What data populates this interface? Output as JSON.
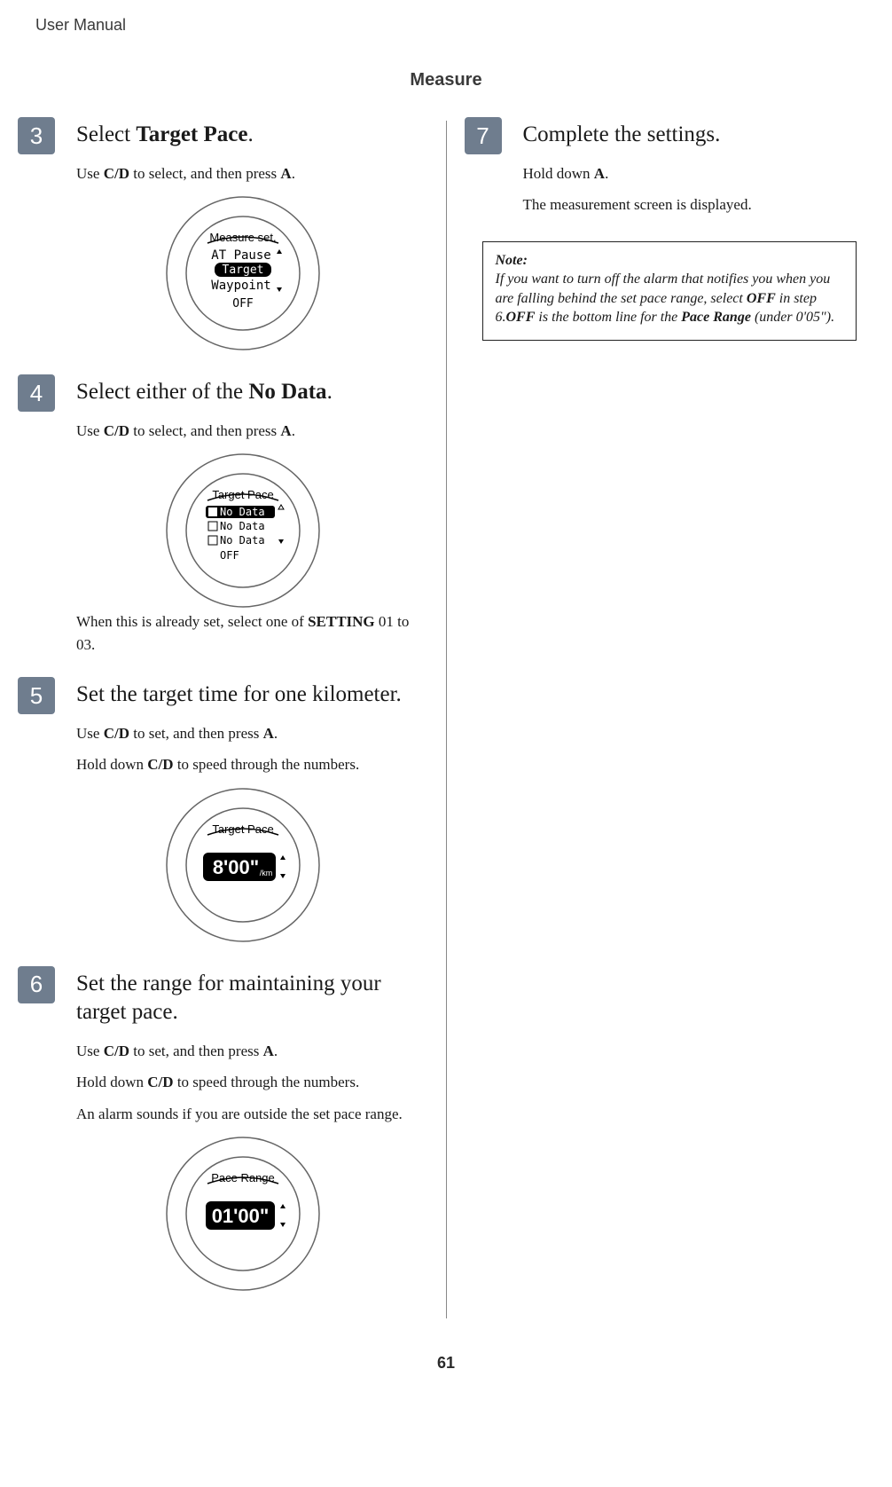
{
  "header": {
    "product": "User Manual",
    "chapter": "Measure"
  },
  "pageNumber": "61",
  "left": {
    "step3": {
      "num": "3",
      "title_pre": "Select ",
      "title_strong": "Target Pace",
      "title_post": ".",
      "body1_pre": "Use ",
      "body1_s1": "C/D",
      "body1_mid": " to select, and then press ",
      "body1_s2": "A",
      "body1_post": ".",
      "screen": {
        "title": "Measure set.",
        "line1": "AT Pause",
        "sel": "Target",
        "line3": "Waypoint",
        "bottom": "OFF"
      }
    },
    "step4": {
      "num": "4",
      "title_pre": "Select either of the ",
      "title_strong": "No Data",
      "title_post": ".",
      "body1_pre": "Use ",
      "body1_s1": "C/D",
      "body1_mid": " to select, and then press ",
      "body1_s2": "A",
      "body1_post": ".",
      "screen": {
        "title": "Target Pace",
        "opt1": "No Data",
        "opt2": "No Data",
        "opt3": "No Data",
        "bottom": "OFF"
      },
      "extra_pre": "When this is already set, select one of ",
      "extra_strong": "SETTING",
      "extra_post": " 01 to 03."
    },
    "step5": {
      "num": "5",
      "title": "Set the target time for one kilometer.",
      "body1_pre": "Use ",
      "body1_s1": "C/D",
      "body1_mid": " to set, and then press ",
      "body1_s2": "A",
      "body1_post": ".",
      "body2_pre": "Hold down ",
      "body2_s1": "C/D",
      "body2_post": " to speed through the numbers.",
      "screen": {
        "title": "Target Pace",
        "value": "8'00\"",
        "unit": "/km"
      }
    },
    "step6": {
      "num": "6",
      "title": "Set the range for maintaining your target pace.",
      "body1_pre": "Use ",
      "body1_s1": "C/D",
      "body1_mid": " to set, and then press ",
      "body1_s2": "A",
      "body1_post": ".",
      "body2_pre": "Hold down ",
      "body2_s1": "C/D",
      "body2_post": " to speed through the numbers.",
      "body3": "An alarm sounds if you are outside the set pace range.",
      "screen": {
        "title": "Pace Range",
        "value": "01'00\""
      }
    }
  },
  "right": {
    "step7": {
      "num": "7",
      "title": "Complete the settings.",
      "body1_pre": "Hold down ",
      "body1_s1": "A",
      "body1_post": ".",
      "body2": "The measurement screen is displayed."
    },
    "note": {
      "label": "Note:",
      "t1": "If you want to turn off the alarm that notifies you when you are falling behind the set pace range, select ",
      "s1": "OFF",
      "t2": " in step 6.",
      "s2": "OFF",
      "t3": " is the bottom line for the ",
      "s3": "Pace Range",
      "t4": " (under 0'05\")."
    }
  }
}
